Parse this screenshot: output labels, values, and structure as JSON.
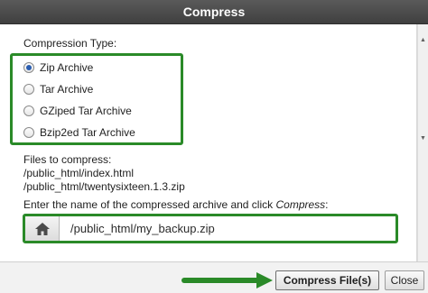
{
  "dialog": {
    "title": "Compress"
  },
  "compression": {
    "heading": "Compression Type:",
    "options": [
      {
        "label": "Zip Archive",
        "checked": true
      },
      {
        "label": "Tar Archive",
        "checked": false
      },
      {
        "label": "GZiped Tar Archive",
        "checked": false
      },
      {
        "label": "Bzip2ed Tar Archive",
        "checked": false
      }
    ]
  },
  "files": {
    "heading": "Files to compress:",
    "items": [
      "/public_html/index.html",
      "/public_html/twentysixteen.1.3.zip"
    ]
  },
  "archive": {
    "prompt_prefix": "Enter the name of the compressed archive and click ",
    "prompt_emphasis": "Compress",
    "prompt_suffix": ":",
    "path_value": "/public_html/my_backup.zip"
  },
  "footer": {
    "compress_label": "Compress File(s)",
    "cancel_label": "Close"
  },
  "colors": {
    "highlight": "#2a8a28",
    "titlebar": "#4a4a4a"
  },
  "icons": {
    "home": "home-icon"
  }
}
